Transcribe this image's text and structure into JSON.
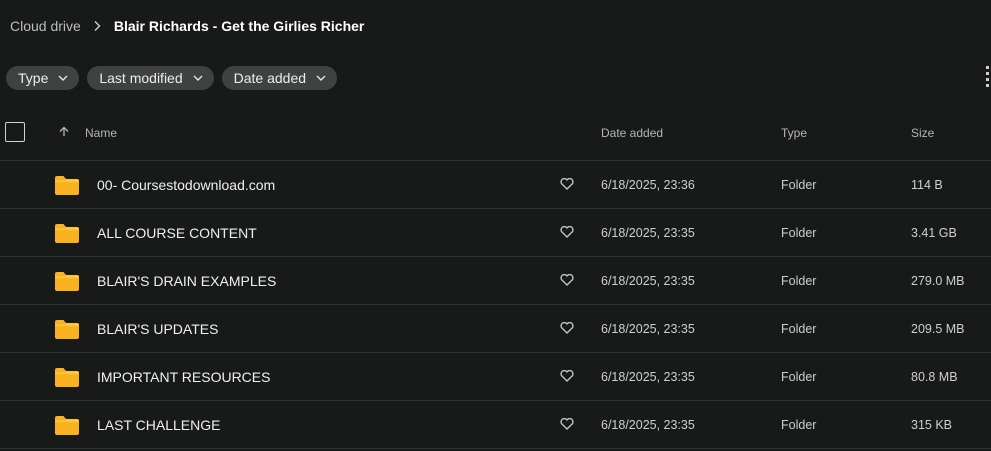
{
  "breadcrumb": {
    "root": "Cloud drive",
    "current": "Blair Richards - Get the Girlies Richer"
  },
  "filters": [
    {
      "label": "Type"
    },
    {
      "label": "Last modified"
    },
    {
      "label": "Date added"
    }
  ],
  "table": {
    "columns": {
      "name": "Name",
      "date_added": "Date added",
      "type": "Type",
      "size": "Size"
    },
    "rows": [
      {
        "name": "00- Coursestodownload.com",
        "date_added": "6/18/2025, 23:36",
        "type": "Folder",
        "size": "114 B"
      },
      {
        "name": "ALL COURSE CONTENT",
        "date_added": "6/18/2025, 23:35",
        "type": "Folder",
        "size": "3.41 GB"
      },
      {
        "name": "BLAIR'S DRAIN EXAMPLES",
        "date_added": "6/18/2025, 23:35",
        "type": "Folder",
        "size": "279.0 MB"
      },
      {
        "name": "BLAIR'S UPDATES",
        "date_added": "6/18/2025, 23:35",
        "type": "Folder",
        "size": "209.5 MB"
      },
      {
        "name": "IMPORTANT RESOURCES",
        "date_added": "6/18/2025, 23:35",
        "type": "Folder",
        "size": "80.8 MB"
      },
      {
        "name": "LAST CHALLENGE",
        "date_added": "6/18/2025, 23:35",
        "type": "Folder",
        "size": "315 KB"
      }
    ]
  },
  "icons": {
    "folder": "folder-icon",
    "favorite": "heart-icon",
    "sort": "arrow-up-icon",
    "separator": "chevron-right-icon",
    "dropdown": "chevron-down-icon",
    "view_toggle": "grid-view-icon"
  },
  "colors": {
    "background": "#181919",
    "chip": "#3f4142",
    "folder": "#f7b322",
    "divider": "#2f3030"
  }
}
